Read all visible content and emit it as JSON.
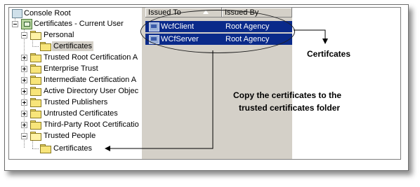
{
  "tree": {
    "root": "Console Root",
    "store": "Certificates - Current User",
    "items": [
      {
        "label": "Personal",
        "expander": "minus"
      },
      {
        "label": "Certificates",
        "expander": "none"
      },
      {
        "label": "Trusted Root Certification A",
        "expander": "plus"
      },
      {
        "label": "Enterprise Trust",
        "expander": "plus"
      },
      {
        "label": "Intermediate Certification A",
        "expander": "plus"
      },
      {
        "label": "Active Directory User Objec",
        "expander": "plus"
      },
      {
        "label": "Trusted Publishers",
        "expander": "plus"
      },
      {
        "label": "Untrusted Certificates",
        "expander": "plus"
      },
      {
        "label": "Third-Party Root Certificatio",
        "expander": "plus"
      },
      {
        "label": "Trusted People",
        "expander": "minus"
      },
      {
        "label": "Certificates",
        "expander": "none"
      }
    ]
  },
  "list": {
    "columns": [
      "Issued To",
      "Issued By"
    ],
    "rows": [
      {
        "issued_to": "WcfClient",
        "issued_by": "Root Agency"
      },
      {
        "issued_to": "WCfServer",
        "issued_by": "Root Agency"
      }
    ]
  },
  "annotations": {
    "label": "Certifcates",
    "instruction_line1": "Copy the certificates to the",
    "instruction_line2": "trusted certificates folder"
  },
  "colors": {
    "selection": "#0a2a8a",
    "pane_bg": "#d4d0c8",
    "folder": "#f8e57a"
  },
  "icons": [
    "console-icon",
    "certificate-store-icon",
    "folder-icon",
    "open-folder-icon",
    "certificate-row-icon",
    "sort-ascending-icon"
  ]
}
